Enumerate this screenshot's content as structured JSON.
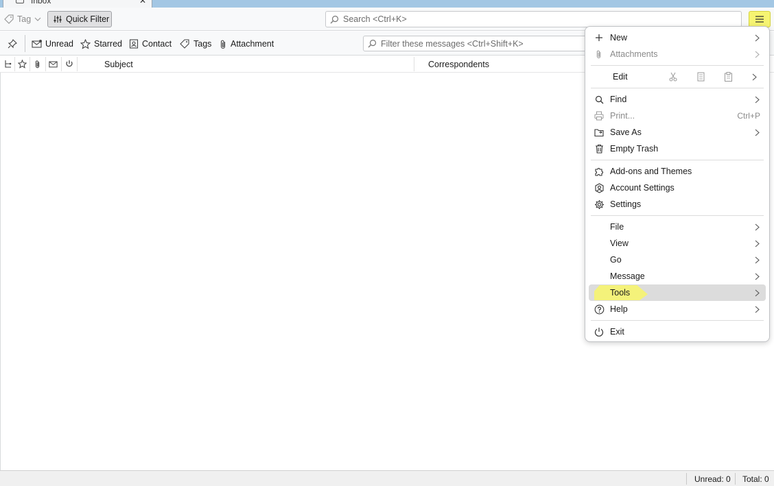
{
  "tab": {
    "label": "Inbox"
  },
  "toolbar": {
    "tag_label": "Tag",
    "quick_filter_label": "Quick Filter",
    "search_placeholder": "Search <Ctrl+K>"
  },
  "quick_filter_bar": {
    "buttons": [
      "Unread",
      "Starred",
      "Contact",
      "Tags",
      "Attachment"
    ],
    "filter_placeholder": "Filter these messages <Ctrl+Shift+K>"
  },
  "columns": {
    "subject": "Subject",
    "correspondents": "Correspondents"
  },
  "status": {
    "unread": "Unread: 0",
    "total": "Total: 0"
  },
  "app_menu": {
    "items": {
      "new": "New",
      "attachments": "Attachments",
      "edit": "Edit",
      "find": "Find",
      "print": "Print...",
      "print_shortcut": "Ctrl+P",
      "save_as": "Save As",
      "empty_trash": "Empty Trash",
      "addons": "Add-ons and Themes",
      "account_settings": "Account Settings",
      "settings": "Settings",
      "file": "File",
      "view": "View",
      "go": "Go",
      "message": "Message",
      "tools": "Tools",
      "help": "Help",
      "exit": "Exit"
    },
    "highlighted_item": "Tools"
  },
  "colors": {
    "highlight": "#f4f27a",
    "menu_hover": "#dcdcdc",
    "tab_strip": "#a3c7e4"
  }
}
